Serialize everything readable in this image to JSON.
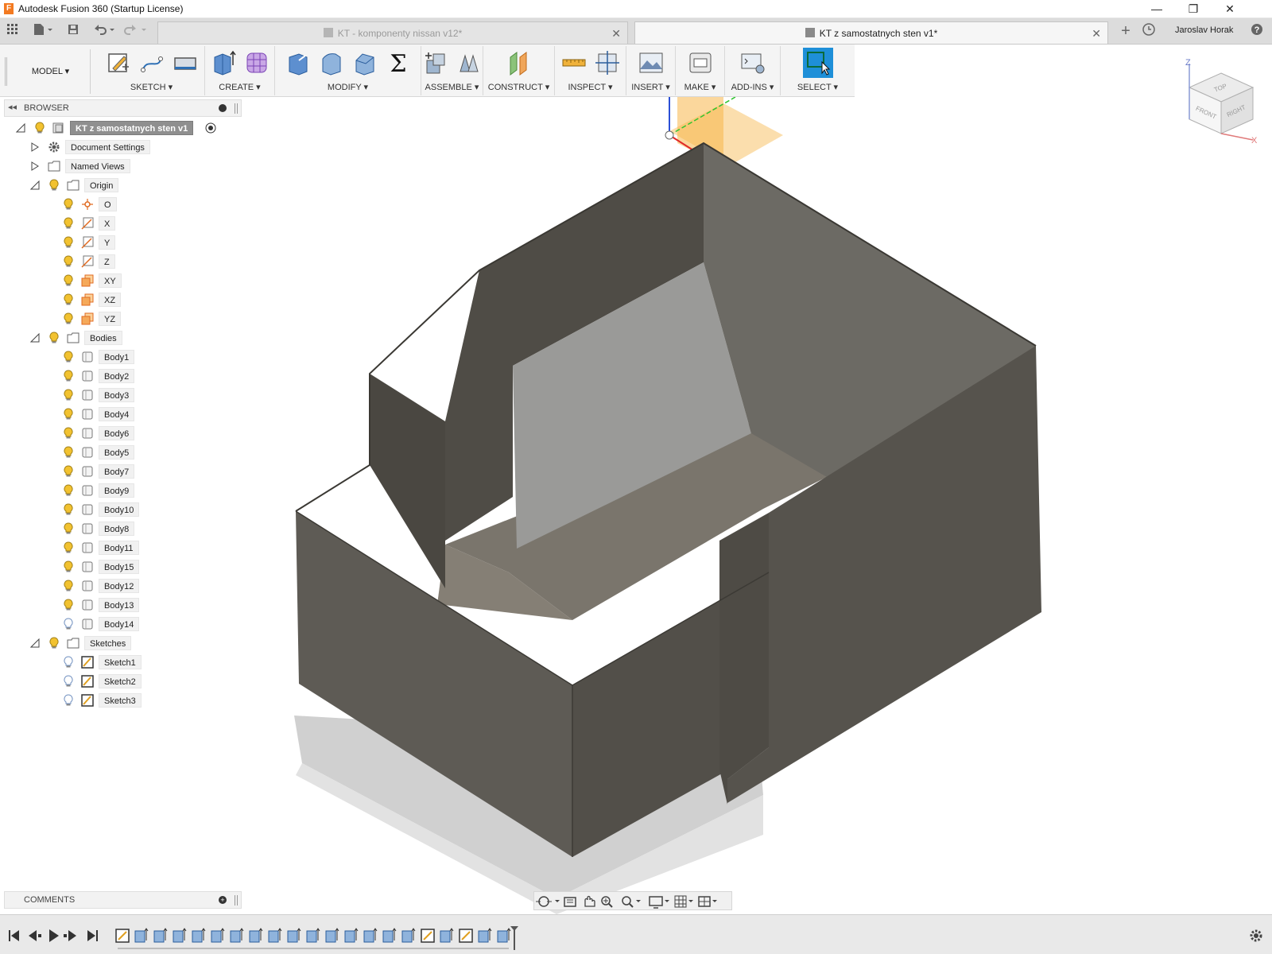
{
  "window": {
    "title": "Autodesk Fusion 360 (Startup License)",
    "controls": [
      "minimize",
      "restore",
      "close"
    ]
  },
  "tabs": [
    {
      "label": "KT - komponenty nissan v12*",
      "active": false
    },
    {
      "label": "KT z samostatnych sten v1*",
      "active": true
    }
  ],
  "user": {
    "name": "Jaroslav Horak"
  },
  "toolbar": {
    "workspace": "MODEL ▾",
    "groups": [
      {
        "label": "SKETCH ▾"
      },
      {
        "label": "CREATE ▾"
      },
      {
        "label": "MODIFY ▾"
      },
      {
        "label": "ASSEMBLE ▾"
      },
      {
        "label": "CONSTRUCT ▾"
      },
      {
        "label": "INSPECT ▾"
      },
      {
        "label": "INSERT ▾"
      },
      {
        "label": "MAKE ▾"
      },
      {
        "label": "ADD-INS ▾"
      },
      {
        "label": "SELECT ▾"
      }
    ]
  },
  "browser": {
    "header": "BROWSER",
    "root": "KT z samostatnych sten v1",
    "document_settings": "Document Settings",
    "named_views": "Named Views",
    "origin": {
      "label": "Origin",
      "items": [
        "O",
        "X",
        "Y",
        "Z",
        "XY",
        "XZ",
        "YZ"
      ]
    },
    "bodies": {
      "label": "Bodies",
      "items": [
        "Body1",
        "Body2",
        "Body3",
        "Body4",
        "Body6",
        "Body5",
        "Body7",
        "Body9",
        "Body10",
        "Body8",
        "Body11",
        "Body15",
        "Body12",
        "Body13",
        "Body14"
      ]
    },
    "sketches": {
      "label": "Sketches",
      "items": [
        "Sketch1",
        "Sketch2",
        "Sketch3"
      ]
    }
  },
  "viewcube": {
    "top": "TOP",
    "front": "FRONT",
    "right": "RIGHT",
    "axis_z": "Z",
    "axis_x": "X"
  },
  "comments": {
    "header": "COMMENTS"
  },
  "colors": {
    "accent": "#1e8fd8",
    "bulb_on": "#f2c230",
    "bulb_off": "#9fb6d6",
    "body": "#5e5a53",
    "plane": "#f7b64a"
  }
}
